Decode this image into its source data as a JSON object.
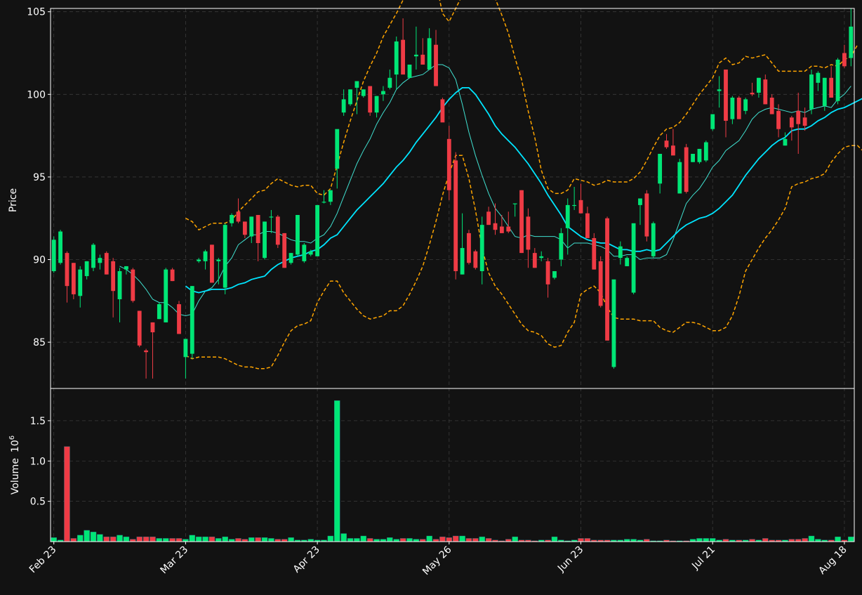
{
  "colors": {
    "background": "#121212",
    "up": "#00e676",
    "down": "#ef3b45",
    "bollinger": "#ffa500",
    "ma_fast": "#40e0d0",
    "ma_slow": "#00e5ff",
    "grid": "#3a3a3a",
    "axis": "#ffffff"
  },
  "chart_data": {
    "type": "candlestick",
    "panels": [
      "price",
      "volume"
    ],
    "ylabel_price": "Price",
    "ylabel_volume": "Volume",
    "volume_multiplier": "10",
    "volume_multiplier_exp": "6",
    "x_tick_labels": [
      "Feb 23",
      "Mar 23",
      "Apr 23",
      "May 26",
      "Jun 23",
      "Jul 21",
      "Aug 18"
    ],
    "x_tick_index": [
      0,
      20,
      40,
      60,
      80,
      100,
      120
    ],
    "price_ylim": [
      82.2,
      105.2
    ],
    "price_yticks": [
      85,
      90,
      95,
      100,
      105
    ],
    "volume_ylim": [
      0,
      1.9
    ],
    "volume_yticks": [
      0.5,
      1.0,
      1.5
    ],
    "grid": true,
    "ohlc": [
      [
        89.3,
        91.4,
        89.2,
        91.2
      ],
      [
        89.8,
        91.8,
        89.7,
        91.7
      ],
      [
        90.4,
        90.5,
        87.4,
        88.4
      ],
      [
        89.8,
        89.8,
        87.6,
        87.9
      ],
      [
        87.8,
        89.6,
        87.1,
        89.4
      ],
      [
        89.0,
        89.9,
        88.8,
        89.9
      ],
      [
        89.5,
        91.0,
        89.3,
        90.9
      ],
      [
        89.8,
        90.3,
        89.4,
        90.1
      ],
      [
        90.4,
        90.5,
        89.1,
        89.1
      ],
      [
        89.9,
        90.1,
        86.5,
        88.1
      ],
      [
        87.6,
        89.5,
        86.2,
        89.3
      ],
      [
        89.4,
        89.6,
        89.1,
        89.6
      ],
      [
        89.4,
        89.5,
        87.4,
        87.5
      ],
      [
        86.9,
        86.9,
        84.7,
        84.8
      ],
      [
        84.5,
        84.6,
        82.8,
        84.4
      ],
      [
        86.2,
        86.2,
        82.8,
        85.6
      ],
      [
        86.4,
        87.4,
        86.4,
        87.3
      ],
      [
        86.2,
        89.5,
        86.2,
        89.4
      ],
      [
        89.4,
        89.5,
        88.7,
        88.7
      ],
      [
        87.3,
        87.5,
        85.5,
        85.5
      ],
      [
        84.1,
        85.2,
        82.8,
        85.2
      ],
      [
        84.3,
        88.4,
        84.0,
        88.4
      ],
      [
        89.9,
        90.1,
        89.8,
        90.0
      ],
      [
        89.9,
        90.6,
        89.4,
        90.5
      ],
      [
        90.9,
        90.9,
        88.6,
        88.6
      ],
      [
        89.9,
        90.1,
        88.5,
        90.0
      ],
      [
        88.3,
        92.2,
        87.9,
        92.1
      ],
      [
        92.2,
        92.8,
        92.0,
        92.7
      ],
      [
        92.9,
        93.7,
        92.2,
        92.3
      ],
      [
        92.3,
        92.3,
        91.3,
        91.5
      ],
      [
        91.4,
        92.6,
        91.0,
        92.6
      ],
      [
        92.7,
        92.7,
        89.9,
        91.0
      ],
      [
        90.1,
        92.3,
        90.0,
        92.3
      ],
      [
        92.6,
        93.0,
        91.6,
        92.6
      ],
      [
        92.6,
        92.7,
        90.7,
        90.9
      ],
      [
        91.6,
        91.6,
        89.5,
        89.5
      ],
      [
        89.8,
        90.4,
        89.7,
        90.4
      ],
      [
        90.3,
        92.7,
        90.2,
        92.7
      ],
      [
        89.9,
        91.0,
        89.8,
        90.9
      ],
      [
        90.3,
        90.6,
        90.2,
        90.5
      ],
      [
        90.2,
        93.3,
        90.2,
        93.3
      ],
      [
        93.5,
        94.2,
        93.4,
        93.5
      ],
      [
        93.5,
        94.2,
        93.3,
        94.2
      ],
      [
        95.5,
        97.2,
        94.3,
        97.9
      ],
      [
        98.9,
        100.3,
        98.7,
        99.7
      ],
      [
        99.4,
        100.3,
        99.3,
        100.3
      ],
      [
        100.4,
        100.5,
        98.8,
        100.8
      ],
      [
        99.9,
        100.3,
        99.8,
        100.3
      ],
      [
        100.5,
        100.5,
        98.7,
        98.9
      ],
      [
        98.9,
        99.9,
        98.6,
        99.9
      ],
      [
        100.0,
        100.5,
        99.6,
        100.2
      ],
      [
        100.4,
        101.5,
        100.3,
        101.0
      ],
      [
        101.2,
        103.5,
        100.3,
        103.2
      ],
      [
        103.3,
        104.6,
        101.9,
        101.2
      ],
      [
        101.0,
        101.7,
        101.0,
        101.8
      ],
      [
        102.3,
        104.1,
        101.5,
        102.4
      ],
      [
        102.4,
        103.4,
        101.9,
        101.8
      ],
      [
        101.5,
        104.0,
        101.5,
        103.4
      ],
      [
        103.0,
        103.9,
        100.5,
        100.5
      ],
      [
        99.7,
        99.8,
        99.4,
        98.3
      ],
      [
        97.3,
        98.1,
        93.6,
        94.2
      ],
      [
        96.0,
        96.5,
        88.8,
        89.3
      ],
      [
        89.1,
        92.8,
        89.1,
        90.7
      ],
      [
        91.6,
        91.8,
        89.7,
        89.8
      ],
      [
        90.5,
        90.6,
        89.4,
        89.5
      ],
      [
        89.3,
        92.6,
        88.5,
        92.1
      ],
      [
        92.9,
        93.2,
        92.1,
        92.1
      ],
      [
        92.2,
        93.4,
        91.5,
        91.8
      ],
      [
        92.0,
        92.7,
        91.6,
        91.6
      ],
      [
        92.0,
        92.9,
        91.6,
        91.7
      ],
      [
        93.4,
        93.4,
        92.6,
        93.4
      ],
      [
        94.2,
        94.2,
        90.4,
        90.4
      ],
      [
        92.6,
        93.1,
        89.5,
        90.6
      ],
      [
        90.4,
        90.7,
        89.5,
        89.5
      ],
      [
        90.1,
        90.5,
        89.9,
        90.2
      ],
      [
        89.9,
        90.1,
        87.7,
        88.5
      ],
      [
        88.9,
        89.2,
        88.8,
        89.3
      ],
      [
        90.0,
        91.9,
        89.6,
        91.6
      ],
      [
        91.9,
        93.7,
        90.3,
        93.3
      ],
      [
        93.3,
        94.4,
        93.0,
        93.3
      ],
      [
        93.6,
        94.6,
        92.8,
        92.8
      ],
      [
        92.8,
        93.2,
        92.1,
        91.3
      ],
      [
        91.3,
        91.6,
        89.4,
        89.4
      ],
      [
        89.9,
        90.2,
        87.1,
        87.2
      ],
      [
        92.5,
        92.6,
        85.1,
        85.1
      ],
      [
        83.5,
        84.0,
        83.4,
        88.8
      ],
      [
        90.1,
        91.1,
        89.7,
        90.8
      ],
      [
        89.6,
        90.2,
        89.6,
        90.1
      ],
      [
        88.0,
        92.0,
        87.9,
        92.2
      ],
      [
        93.3,
        93.6,
        92.1,
        93.7
      ],
      [
        94.0,
        94.2,
        91.1,
        91.4
      ],
      [
        90.2,
        92.3,
        90.1,
        92.2
      ],
      [
        94.6,
        96.3,
        94.0,
        96.4
      ],
      [
        97.2,
        97.6,
        96.7,
        96.8
      ],
      [
        96.9,
        97.9,
        96.8,
        96.3
      ],
      [
        94.0,
        96.1,
        94.0,
        95.9
      ],
      [
        96.8,
        97.0,
        94.0,
        94.1
      ],
      [
        95.9,
        96.4,
        95.9,
        96.4
      ],
      [
        95.9,
        96.7,
        95.8,
        96.7
      ],
      [
        96.0,
        97.2,
        95.9,
        97.1
      ],
      [
        97.9,
        98.8,
        97.8,
        98.8
      ],
      [
        100.2,
        101.1,
        99.2,
        100.3
      ],
      [
        101.5,
        101.5,
        97.4,
        98.4
      ],
      [
        98.5,
        99.9,
        98.2,
        99.8
      ],
      [
        99.8,
        99.9,
        98.5,
        98.5
      ],
      [
        99.0,
        99.8,
        98.8,
        99.7
      ],
      [
        100.1,
        100.7,
        99.9,
        100.0
      ],
      [
        100.1,
        101.0,
        99.8,
        101.0
      ],
      [
        100.9,
        101.2,
        99.4,
        99.4
      ],
      [
        99.8,
        100.0,
        98.8,
        98.8
      ],
      [
        99.0,
        99.4,
        97.4,
        97.9
      ],
      [
        96.9,
        97.7,
        96.9,
        97.3
      ],
      [
        98.6,
        98.7,
        97.2,
        98.0
      ],
      [
        99.0,
        100.1,
        96.4,
        98.2
      ],
      [
        98.6,
        99.2,
        97.8,
        98.1
      ],
      [
        99.1,
        101.5,
        98.8,
        101.2
      ],
      [
        100.7,
        101.4,
        100.2,
        101.3
      ],
      [
        99.3,
        101.0,
        99.0,
        101.0
      ],
      [
        101.0,
        101.7,
        99.8,
        99.8
      ],
      [
        99.6,
        102.2,
        99.4,
        102.1
      ],
      [
        102.5,
        103.0,
        101.6,
        101.7
      ],
      [
        102.2,
        105.2,
        101.7,
        104.1
      ]
    ],
    "volume": [
      0.05,
      0.02,
      1.18,
      0.04,
      0.08,
      0.14,
      0.12,
      0.09,
      0.06,
      0.06,
      0.08,
      0.06,
      0.03,
      0.06,
      0.06,
      0.06,
      0.04,
      0.04,
      0.04,
      0.04,
      0.03,
      0.08,
      0.06,
      0.06,
      0.06,
      0.04,
      0.06,
      0.03,
      0.04,
      0.03,
      0.05,
      0.05,
      0.05,
      0.04,
      0.03,
      0.03,
      0.05,
      0.02,
      0.02,
      0.03,
      0.02,
      0.02,
      0.07,
      1.75,
      0.1,
      0.04,
      0.04,
      0.07,
      0.04,
      0.03,
      0.03,
      0.05,
      0.03,
      0.04,
      0.04,
      0.03,
      0.03,
      0.07,
      0.03,
      0.06,
      0.05,
      0.07,
      0.07,
      0.04,
      0.04,
      0.06,
      0.04,
      0.02,
      0.01,
      0.03,
      0.06,
      0.02,
      0.02,
      0.01,
      0.02,
      0.02,
      0.06,
      0.02,
      0.01,
      0.02,
      0.04,
      0.04,
      0.02,
      0.02,
      0.02,
      0.02,
      0.02,
      0.03,
      0.03,
      0.02,
      0.03,
      0.01,
      0.01,
      0.02,
      0.01,
      0.01,
      0.01,
      0.03,
      0.04,
      0.04,
      0.04,
      0.02,
      0.03,
      0.02,
      0.02,
      0.02,
      0.03,
      0.02,
      0.04,
      0.02,
      0.02,
      0.02,
      0.03,
      0.03,
      0.04,
      0.07,
      0.03,
      0.02,
      0.02,
      0.06,
      0.02,
      0.06
    ],
    "ma_fast": [
      null,
      null,
      null,
      null,
      null,
      null,
      null,
      null,
      null,
      null,
      89.6,
      89.4,
      89.1,
      88.7,
      88.2,
      87.6,
      87.4,
      87.4,
      87.1,
      86.7,
      86.6,
      86.7,
      87.5,
      88.1,
      88.3,
      88.8,
      89.6,
      90.1,
      90.9,
      91.2,
      91.5,
      91.5,
      91.7,
      91.7,
      91.6,
      91.4,
      91.2,
      91.1,
      91.1,
      91.0,
      91.3,
      91.5,
      92.0,
      92.8,
      93.8,
      94.8,
      95.8,
      96.6,
      97.3,
      98.2,
      98.9,
      99.5,
      100.3,
      100.7,
      101.0,
      101.1,
      101.2,
      101.5,
      101.8,
      101.8,
      101.6,
      100.9,
      99.4,
      97.7,
      96.3,
      95.1,
      94.0,
      93.1,
      92.6,
      92.0,
      91.4,
      91.3,
      91.5,
      91.4,
      91.4,
      91.4,
      91.4,
      91.2,
      90.7,
      91.0,
      91.0,
      91.0,
      90.9,
      90.8,
      90.6,
      90.2,
      90.2,
      90.3,
      90.3,
      90.0,
      90.1,
      90.1,
      90.1,
      90.3,
      91.2,
      92.3,
      93.4,
      93.9,
      94.3,
      94.9,
      95.6,
      96.0,
      96.6,
      96.9,
      97.2,
      97.8,
      98.5,
      98.9,
      99.1,
      99.2,
      99.1,
      99.0,
      98.9,
      99.0,
      98.9,
      99.1,
      99.2,
      99.3,
      99.2,
      99.7,
      100.0,
      100.5
    ],
    "ma_slow": [
      null,
      null,
      null,
      null,
      null,
      null,
      null,
      null,
      null,
      null,
      null,
      null,
      null,
      null,
      null,
      null,
      null,
      null,
      null,
      null,
      88.4,
      88.1,
      88.0,
      88.1,
      88.2,
      88.2,
      88.2,
      88.3,
      88.5,
      88.6,
      88.8,
      88.9,
      89.0,
      89.4,
      89.7,
      89.9,
      90.1,
      90.2,
      90.3,
      90.5,
      90.6,
      90.9,
      91.3,
      91.5,
      92.0,
      92.5,
      93.0,
      93.4,
      93.8,
      94.2,
      94.6,
      95.1,
      95.6,
      96.0,
      96.5,
      97.1,
      97.6,
      98.1,
      98.6,
      99.2,
      99.7,
      100.1,
      100.4,
      100.4,
      100.0,
      99.4,
      98.8,
      98.1,
      97.6,
      97.2,
      96.8,
      96.3,
      95.8,
      95.2,
      94.6,
      93.9,
      93.3,
      92.7,
      92.0,
      91.7,
      91.4,
      91.2,
      91.1,
      91.0,
      91.0,
      90.8,
      90.6,
      90.6,
      90.5,
      90.5,
      90.6,
      90.5,
      90.6,
      91.0,
      91.4,
      91.8,
      92.1,
      92.3,
      92.5,
      92.6,
      92.8,
      93.1,
      93.5,
      93.9,
      94.5,
      95.1,
      95.6,
      96.1,
      96.5,
      96.9,
      97.2,
      97.4,
      97.8,
      97.9,
      97.9,
      98.1,
      98.4,
      98.6,
      98.9,
      99.1,
      99.2,
      99.4,
      99.6,
      99.8
    ],
    "bb_upper": [
      null,
      null,
      null,
      null,
      null,
      null,
      null,
      null,
      null,
      null,
      null,
      null,
      null,
      null,
      null,
      null,
      null,
      null,
      null,
      null,
      92.5,
      92.3,
      91.8,
      92.0,
      92.2,
      92.2,
      92.2,
      92.4,
      92.9,
      93.3,
      93.7,
      94.1,
      94.2,
      94.6,
      94.9,
      94.7,
      94.5,
      94.4,
      94.5,
      94.5,
      94.0,
      93.9,
      94.3,
      95.7,
      97.1,
      98.4,
      99.6,
      100.8,
      101.7,
      102.5,
      103.5,
      104.2,
      104.9,
      105.7,
      106.6,
      107.4,
      107.9,
      107.6,
      106.8,
      104.9,
      104.4,
      105.2,
      106.0,
      107.8,
      108.6,
      108.3,
      107.1,
      105.8,
      104.8,
      103.7,
      102.2,
      100.9,
      99.0,
      97.4,
      95.4,
      94.3,
      94.0,
      94.0,
      94.2,
      94.9,
      94.8,
      94.7,
      94.5,
      94.6,
      94.8,
      94.7,
      94.7,
      94.7,
      94.9,
      95.3,
      96.0,
      96.8,
      97.5,
      97.9,
      98.0,
      98.3,
      98.8,
      99.4,
      100.0,
      100.5,
      101.0,
      101.9,
      102.2,
      101.8,
      101.9,
      102.3,
      102.2,
      102.3,
      102.4,
      101.9,
      101.4,
      101.4,
      101.4,
      101.4,
      101.4,
      101.7,
      101.7,
      101.6,
      101.8,
      101.7,
      102.1,
      102.3,
      103.0
    ],
    "bb_lower": [
      null,
      null,
      null,
      null,
      null,
      null,
      null,
      null,
      null,
      null,
      null,
      null,
      null,
      null,
      null,
      null,
      null,
      null,
      null,
      null,
      84.2,
      84.0,
      84.1,
      84.1,
      84.1,
      84.1,
      84.0,
      83.8,
      83.6,
      83.5,
      83.5,
      83.4,
      83.4,
      83.5,
      84.2,
      85.0,
      85.7,
      86.0,
      86.1,
      86.3,
      87.4,
      88.1,
      88.7,
      88.7,
      88.0,
      87.5,
      87.0,
      86.6,
      86.4,
      86.5,
      86.6,
      86.9,
      86.9,
      87.2,
      87.9,
      88.7,
      89.6,
      90.9,
      92.3,
      93.9,
      95.2,
      96.3,
      96.3,
      94.9,
      93.0,
      90.7,
      89.2,
      88.4,
      87.9,
      87.3,
      86.7,
      86.1,
      85.7,
      85.6,
      85.4,
      84.9,
      84.7,
      84.8,
      85.6,
      86.2,
      87.9,
      88.2,
      88.4,
      88.0,
      87.1,
      86.5,
      86.4,
      86.4,
      86.4,
      86.3,
      86.3,
      86.3,
      85.9,
      85.7,
      85.6,
      85.9,
      86.2,
      86.2,
      86.1,
      85.9,
      85.7,
      85.7,
      85.9,
      86.6,
      87.8,
      89.3,
      90.0,
      90.7,
      91.3,
      91.8,
      92.4,
      93.1,
      94.4,
      94.6,
      94.7,
      94.9,
      95.0,
      95.2,
      95.9,
      96.4,
      96.8,
      96.9,
      96.9,
      96.5
    ]
  }
}
